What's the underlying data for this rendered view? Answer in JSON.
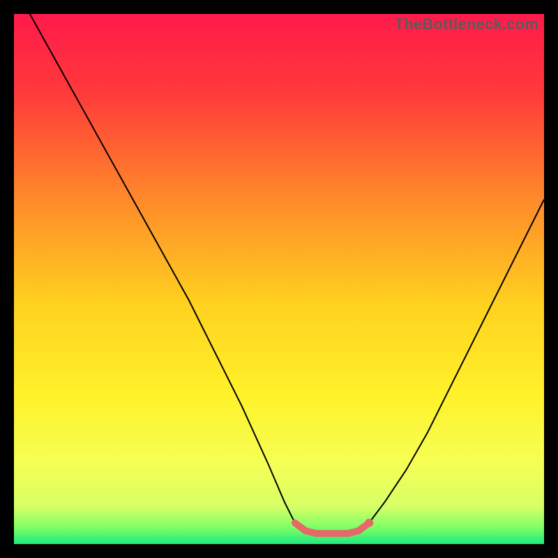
{
  "watermark": "TheBottleneck.com",
  "chart_data": {
    "type": "line",
    "title": "",
    "xlabel": "",
    "ylabel": "",
    "xlim": [
      0,
      100
    ],
    "ylim": [
      0,
      100
    ],
    "grid": false,
    "legend": false,
    "background": {
      "type": "vertical-gradient",
      "stops": [
        {
          "pos": 0.0,
          "color": "#ff1a4b"
        },
        {
          "pos": 0.15,
          "color": "#ff3a3a"
        },
        {
          "pos": 0.35,
          "color": "#ff8a2a"
        },
        {
          "pos": 0.55,
          "color": "#ffd21f"
        },
        {
          "pos": 0.72,
          "color": "#fff22a"
        },
        {
          "pos": 0.85,
          "color": "#f5ff55"
        },
        {
          "pos": 0.93,
          "color": "#d6ff66"
        },
        {
          "pos": 0.97,
          "color": "#7cff66"
        },
        {
          "pos": 1.0,
          "color": "#1de981"
        }
      ]
    },
    "series": [
      {
        "name": "curve-left",
        "stroke": "#000000",
        "strokeWidth": 2,
        "x": [
          3,
          8,
          13,
          18,
          23,
          28,
          33,
          38,
          43,
          48,
          51,
          53
        ],
        "y": [
          100,
          91,
          82,
          73,
          64,
          55,
          46,
          36,
          26,
          15,
          8,
          4
        ]
      },
      {
        "name": "curve-right",
        "stroke": "#000000",
        "strokeWidth": 2,
        "x": [
          67,
          70,
          74,
          78,
          82,
          86,
          90,
          94,
          97,
          100
        ],
        "y": [
          4,
          8,
          14,
          21,
          29,
          37,
          45,
          53,
          59,
          65
        ]
      },
      {
        "name": "flat-bottom-highlight",
        "stroke": "#e46a6a",
        "strokeWidth": 10,
        "linecap": "round",
        "x": [
          53,
          55,
          57,
          59,
          61,
          63,
          65,
          67
        ],
        "y": [
          4,
          2.5,
          2,
          2,
          2,
          2,
          2.5,
          4
        ]
      }
    ],
    "markers": [
      {
        "name": "end-dot-right",
        "x": 67,
        "y": 4,
        "r": 6,
        "fill": "#e46a6a"
      }
    ]
  }
}
